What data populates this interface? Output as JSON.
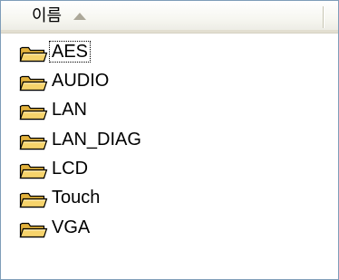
{
  "header": {
    "name_column_label": "이름",
    "sort_icon": "sort-ascending-icon"
  },
  "list": {
    "items": [
      {
        "label": "AES",
        "icon": "folder-icon",
        "focused": true
      },
      {
        "label": "AUDIO",
        "icon": "folder-icon",
        "focused": false
      },
      {
        "label": "LAN",
        "icon": "folder-icon",
        "focused": false
      },
      {
        "label": "LAN_DIAG",
        "icon": "folder-icon",
        "focused": false
      },
      {
        "label": "LCD",
        "icon": "folder-icon",
        "focused": false
      },
      {
        "label": "Touch",
        "icon": "folder-icon",
        "focused": false
      },
      {
        "label": "VGA",
        "icon": "folder-icon",
        "focused": false
      }
    ]
  },
  "colors": {
    "folder_fill": "#f6d36b",
    "folder_shade": "#e3b23c",
    "folder_outline": "#000000",
    "border": "#7f9db9"
  }
}
